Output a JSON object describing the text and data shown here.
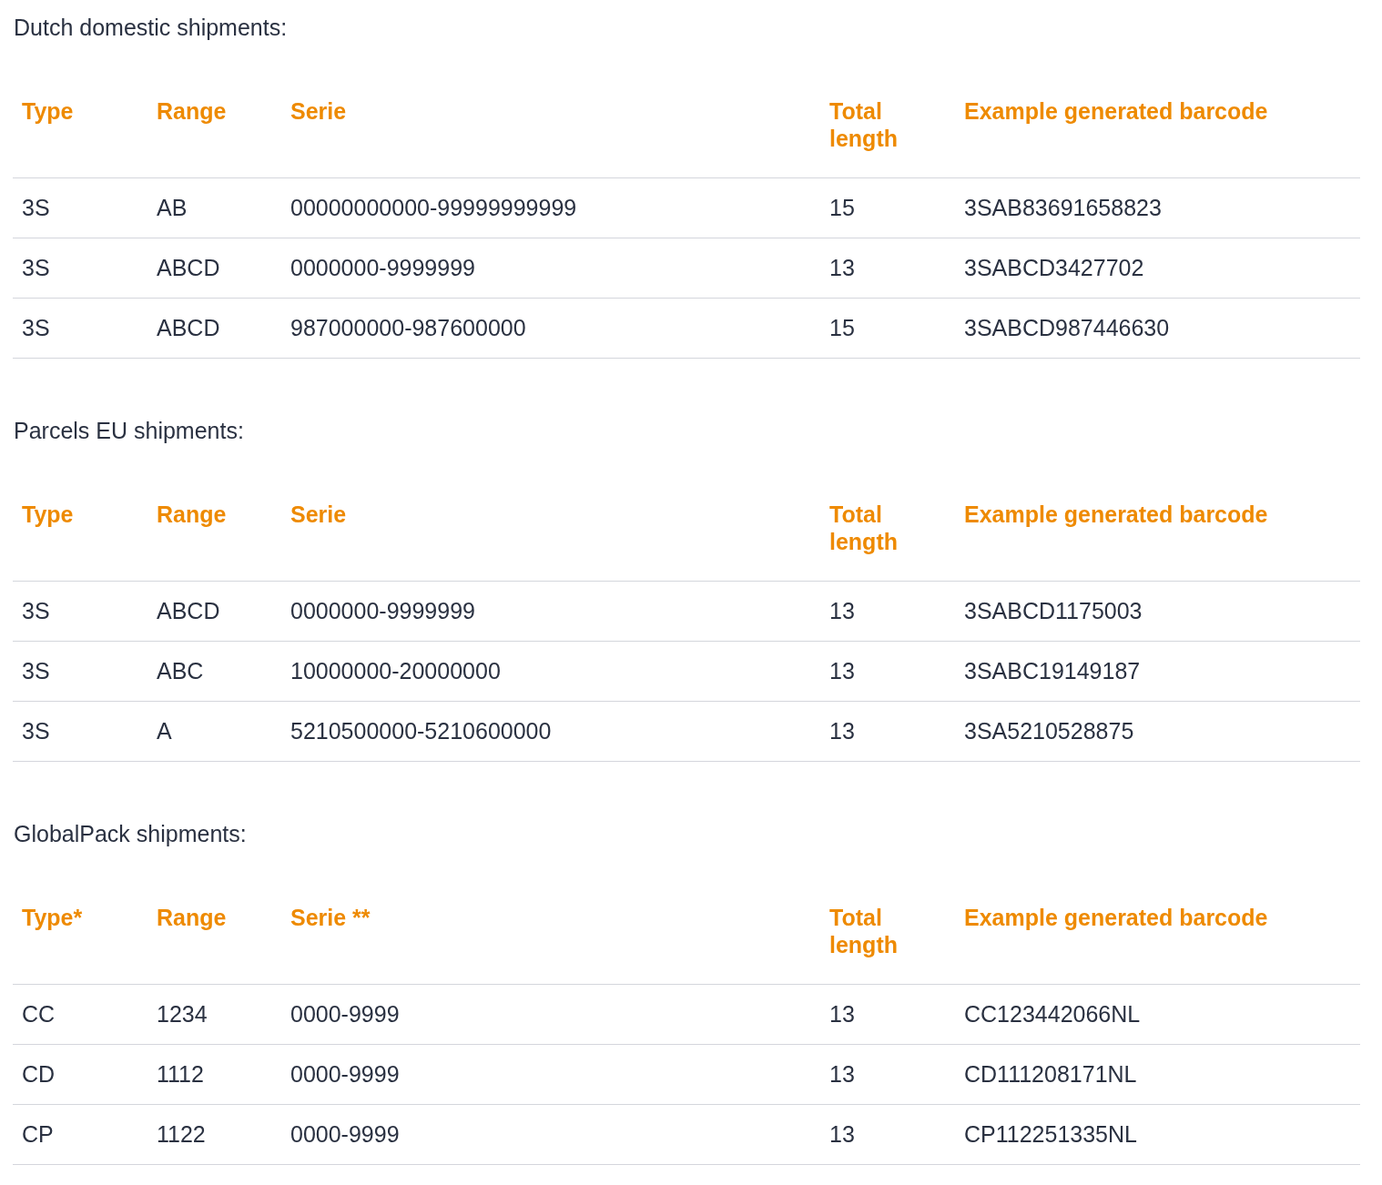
{
  "sections": [
    {
      "title": "Dutch domestic shipments:",
      "columns": [
        "Type",
        "Range",
        "Serie",
        "Total length",
        "Example generated barcode"
      ],
      "rows": [
        [
          "3S",
          "AB",
          "00000000000-99999999999",
          "15",
          "3SAB83691658823"
        ],
        [
          "3S",
          "ABCD",
          "0000000-9999999",
          "13",
          "3SABCD3427702"
        ],
        [
          "3S",
          "ABCD",
          "987000000-987600000",
          "15",
          "3SABCD987446630"
        ]
      ]
    },
    {
      "title": "Parcels EU shipments:",
      "columns": [
        "Type",
        "Range",
        "Serie",
        "Total length",
        "Example generated barcode"
      ],
      "rows": [
        [
          "3S",
          "ABCD",
          "0000000-9999999",
          "13",
          "3SABCD1175003"
        ],
        [
          "3S",
          "ABC",
          "10000000-20000000",
          "13",
          "3SABC19149187"
        ],
        [
          "3S",
          "A",
          "5210500000-5210600000",
          "13",
          "3SA5210528875"
        ]
      ]
    },
    {
      "title": "GlobalPack shipments:",
      "columns": [
        "Type*",
        "Range",
        "Serie **",
        "Total length",
        "Example generated barcode"
      ],
      "rows": [
        [
          "CC",
          "1234",
          "0000-9999",
          "13",
          "CC123442066NL"
        ],
        [
          "CD",
          "1112",
          "0000-9999",
          "13",
          "CD111208171NL"
        ],
        [
          "CP",
          "1122",
          "0000-9999",
          "13",
          "CP112251335NL"
        ]
      ]
    }
  ]
}
